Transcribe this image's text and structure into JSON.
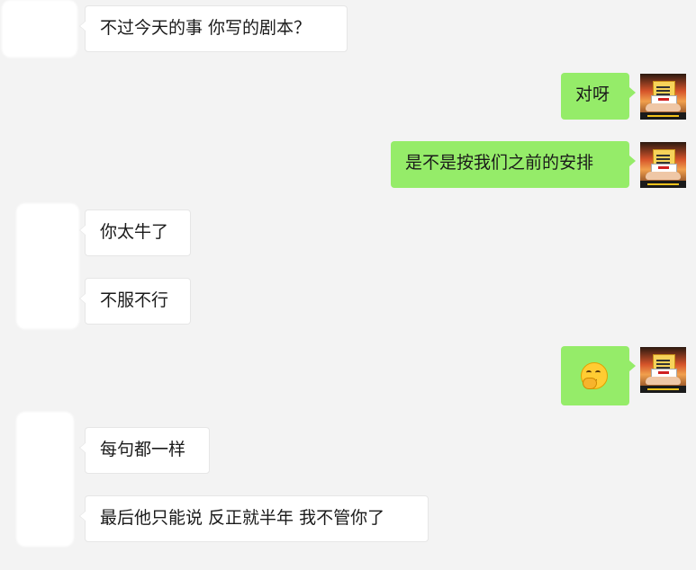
{
  "messages": [
    {
      "side": "in",
      "text": "不过今天的事 你写的剧本？"
    },
    {
      "side": "out",
      "text": "对呀"
    },
    {
      "side": "out",
      "text": "是不是按我们之前的安排"
    },
    {
      "side": "in",
      "text": "你太牛了"
    },
    {
      "side": "in",
      "text": "不服不行"
    },
    {
      "side": "out",
      "emoji": "hand-over-mouth-emoji"
    },
    {
      "side": "in",
      "text": "每句都一样"
    },
    {
      "side": "in",
      "text": "最后他只能说 反正就半年 我不管你了"
    }
  ],
  "colors": {
    "background": "#f3f3f3",
    "incoming_bubble": "#ffffff",
    "outgoing_bubble": "#95ec69"
  }
}
